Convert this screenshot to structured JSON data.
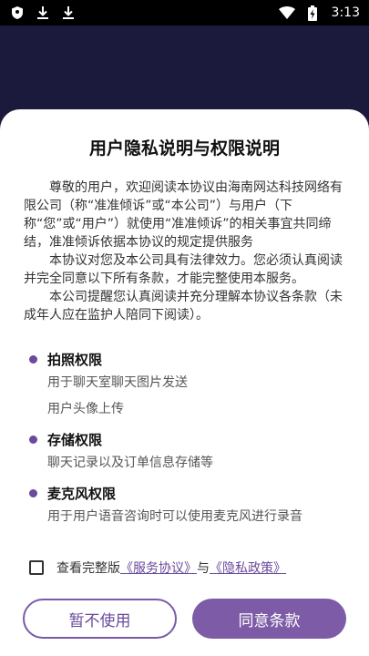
{
  "status_bar": {
    "left_icons": [
      "shield-icon",
      "download-icon",
      "download-icon"
    ],
    "right_icons": [
      "wifi-icon",
      "battery-charging-icon"
    ],
    "time": "3:13"
  },
  "dialog": {
    "title": "用户隐私说明与权限说明",
    "paragraphs": [
      "尊敬的用户，欢迎阅读本协议由海南网达科技网络有限公司（称“准准倾诉”或“本公司”）与用户（下称“您”或“用户”）就使用“准准倾诉”的相关事宜共同缔结，准准倾诉依据本协议的规定提供服务",
      "本协议对您及本公司具有法律效力。您必须认真阅读并完全同意以下所有条款，才能完整使用本服务。",
      "本公司提醒您认真阅读并充分理解本协议各条款（未成年人应在监护人陪同下阅读）。"
    ],
    "permissions": [
      {
        "title": "拍照权限",
        "descriptions": [
          "用于聊天室聊天图片发送",
          "用户头像上传"
        ]
      },
      {
        "title": "存储权限",
        "descriptions": [
          "聊天记录以及订单信息存储等"
        ]
      },
      {
        "title": "麦克风权限",
        "descriptions": [
          "用于用户语音咨询时可以使用麦克风进行录音"
        ]
      }
    ],
    "agreement": {
      "prefix": "查看完整版",
      "service_link": "《服务协议》",
      "connector": "与",
      "privacy_link": "《隐私政策》",
      "checked": false
    },
    "buttons": {
      "decline": "暂不使用",
      "accept": "同意条款"
    }
  },
  "colors": {
    "accent": "#7d5ba6",
    "backdrop": "#1c1a3c"
  }
}
